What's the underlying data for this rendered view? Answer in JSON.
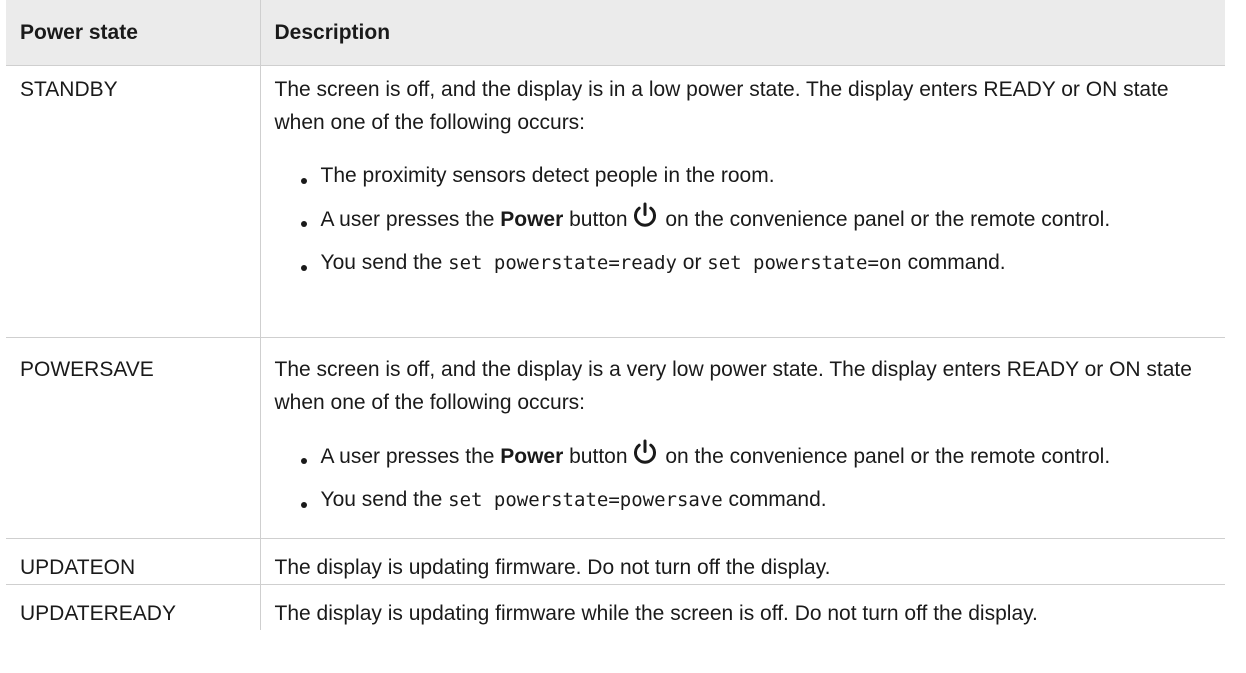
{
  "table": {
    "header": {
      "col1": "Power state",
      "col2": "Description"
    },
    "rows": [
      {
        "state": "STANDBY",
        "description": "The screen is off, and the display is in a low power state. The display enters READY or ON state when one of the following occurs:",
        "bullets": {
          "b1": "The proximity sensors detect people in the room.",
          "b2": {
            "pre": "A user presses the ",
            "bold": "Power",
            "mid": " button",
            "icon": "power-icon",
            "post": " on the convenience panel or the remote control."
          },
          "b3": {
            "pre": "You send the ",
            "code1": "set powerstate=ready",
            "mid": " or ",
            "code2": "set powerstate=on",
            "post": " command."
          }
        }
      },
      {
        "state": "POWERSAVE",
        "description": "The screen is off, and the display is a very low power state. The display enters READY or ON state when one of the following occurs:",
        "bullets": {
          "b1": {
            "pre": "A user presses the ",
            "bold": "Power",
            "mid": " button",
            "icon": "power-icon",
            "post": " on the convenience panel or the remote control."
          },
          "b2": {
            "pre": "You send the ",
            "code": "set powerstate=powersave",
            "post": " command."
          }
        }
      },
      {
        "state": "UPDATEON",
        "description": "The display is updating firmware. Do not turn off the display."
      },
      {
        "state": "UPDATEREADY",
        "description": "The display is updating firmware while the screen is off. Do not turn off the display."
      }
    ]
  }
}
